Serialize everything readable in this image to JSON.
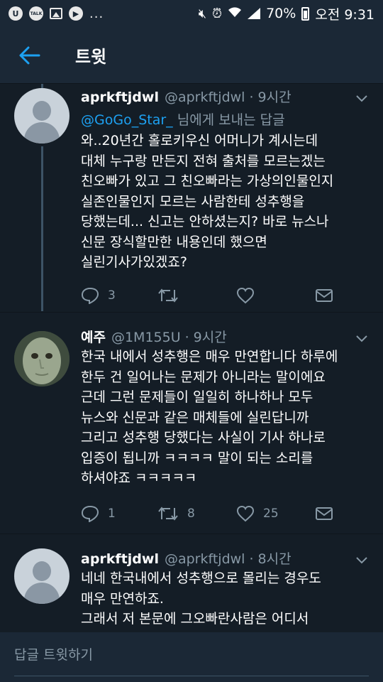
{
  "status_bar": {
    "left_icons": [
      "u-plus-icon",
      "kakaotalk-icon",
      "gallery-icon",
      "play-icon"
    ],
    "talk_label": "TALK",
    "more": "...",
    "battery": "70%",
    "time": "오전 9:31"
  },
  "app_bar": {
    "title": "트윗"
  },
  "tweets": [
    {
      "name": "aprkftjdwl",
      "handle": "@aprkftjdwl",
      "dot": "·",
      "time": "9시간",
      "reply_prefix": "@GoGo_Star_",
      "reply_suffix": " 님에게 보내는 답글",
      "lines": [
        "와..20년간 홀로키우신 어머니가 계시는데",
        "대체 누구랑 만든지 전혀 출처를 모르는겠는",
        "친오빠가 있고 그 친오빠라는 가상의인물인지",
        "실존인물인지 모르는 사람한테 성추행을",
        "당했는데... 신고는 안하셨는지? 바로 뉴스나",
        "신문 장식할만한 내용인데 했으면",
        "실린기사가있겠죠?"
      ],
      "replies": "3",
      "retweets": "",
      "likes": ""
    },
    {
      "name": "예주",
      "handle": "@1M155U",
      "dot": "·",
      "time": "9시간",
      "lines": [
        "한국 내에서 성추행은 매우 만연합니다 하루에",
        "한두 건 일어나는 문제가 아니라는 말이에요",
        "근데 그런 문제들이 일일히 하나하나 모두",
        "뉴스와 신문과 같은 매체들에 실린답니까",
        "그리고 성추행 당했다는 사실이 기사 하나로",
        "입증이 됩니까 ㅋㅋㅋㅋ 말이 되는 소리를",
        "하셔야죠 ㅋㅋㅋㅋㅋ"
      ],
      "replies": "1",
      "retweets": "8",
      "likes": "25"
    },
    {
      "name": "aprkftjdwl",
      "handle": "@aprkftjdwl",
      "dot": "·",
      "time": "8시간",
      "lines": [
        "네네 한국내에서 성추행으로 몰리는 경우도",
        "매우 만연하죠.",
        "그래서 저 본문에 그오빠란사람은 어디서"
      ]
    }
  ],
  "reply_bar": {
    "placeholder": "답글 트윗하기"
  },
  "colors": {
    "background": "#141d26",
    "bar": "#1b2836",
    "text": "#ffffff",
    "secondary": "#8899a6",
    "accent": "#1da1f2"
  }
}
